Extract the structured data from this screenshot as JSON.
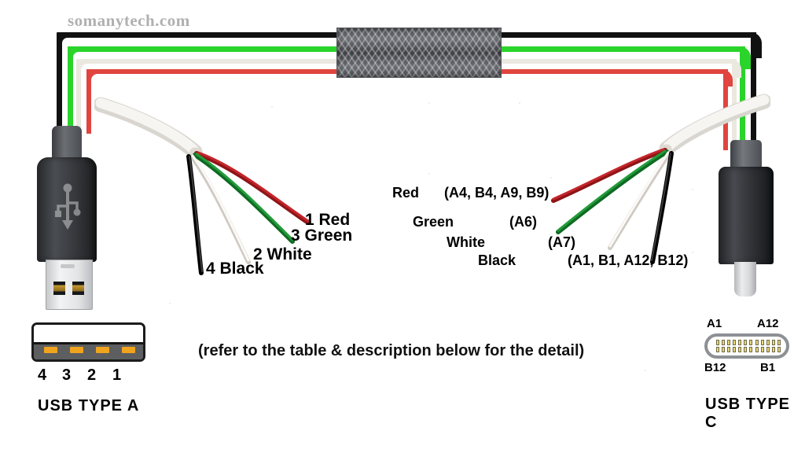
{
  "watermark": "somanytech.com",
  "cable": {
    "wire_colors": {
      "black": "#111111",
      "green": "#2bd42b",
      "white": "#ebe8e0",
      "red": "#e0453f"
    },
    "sleeve": "braided-shield-sleeve",
    "jacket_color": "#f2f0ec"
  },
  "type_a_wire_labels": [
    {
      "id": "red",
      "text": "1 Red",
      "pin": "1",
      "color": "Red"
    },
    {
      "id": "green",
      "text": "3 Green",
      "pin": "3",
      "color": "Green"
    },
    {
      "id": "white",
      "text": "2 White",
      "pin": "2",
      "color": "White"
    },
    {
      "id": "black",
      "text": "4 Black",
      "pin": "4",
      "color": "Black"
    }
  ],
  "type_c_wire_labels": [
    {
      "id": "red",
      "name": "Red",
      "pins": "(A4, B4, A9, B9)"
    },
    {
      "id": "green",
      "name": "Green",
      "pins": "(A6)"
    },
    {
      "id": "white",
      "name": "White",
      "pins": "(A7)"
    },
    {
      "id": "black",
      "name": "Black",
      "pins": "(A1, B1, A12, B12)"
    }
  ],
  "note": "(refer to the table & description below for the detail)",
  "connector_a": {
    "caption": "USB TYPE A",
    "pin_numbers": [
      "4",
      "3",
      "2",
      "1"
    ],
    "pin_count": 4,
    "contact_color": "#f0a41e"
  },
  "connector_c": {
    "caption": "USB TYPE C",
    "corner_labels": {
      "top_left": "A1",
      "top_right": "A12",
      "bottom_left": "B12",
      "bottom_right": "B1"
    },
    "pins_per_row": 12,
    "rows": 2,
    "contact_color": "#e8d679"
  },
  "plugs": {
    "left_plug": "usb-type-a-plug",
    "right_plug": "usb-type-c-plug",
    "logo": "usb-trident-logo"
  }
}
